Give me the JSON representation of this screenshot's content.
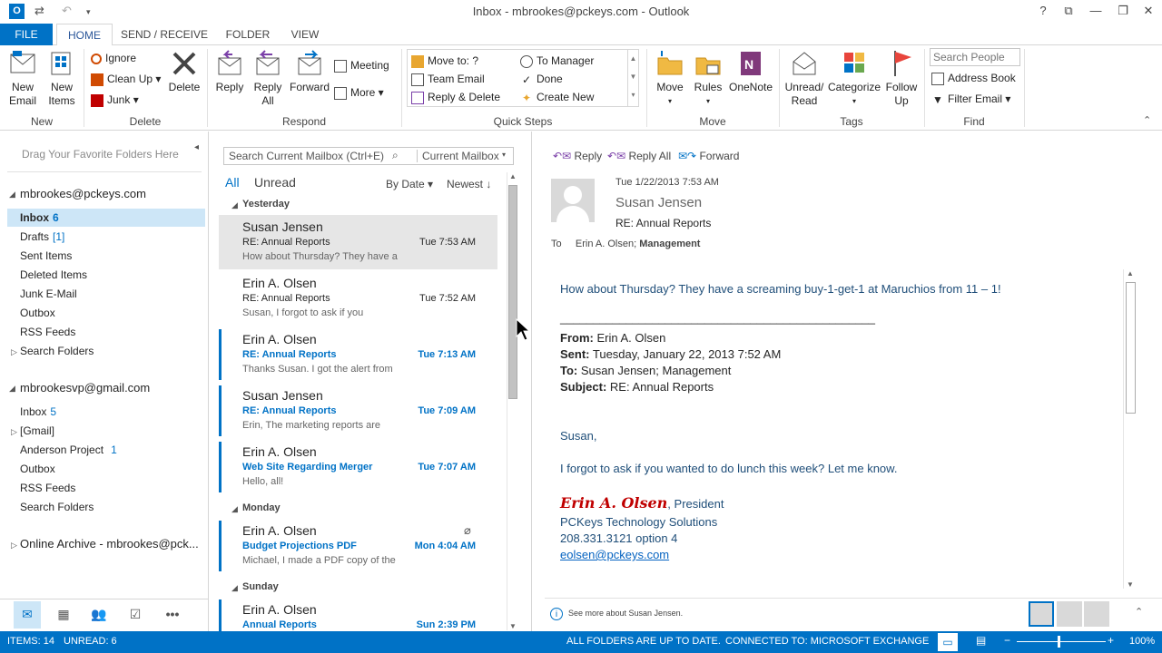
{
  "window": {
    "title": "Inbox - mbrookes@pckeys.com - Outlook"
  },
  "tabs": [
    "FILE",
    "HOME",
    "SEND / RECEIVE",
    "FOLDER",
    "VIEW"
  ],
  "ribbon": {
    "new_group": {
      "label": "New",
      "new_email": "New Email",
      "new_items": "New Items"
    },
    "delete_group": {
      "label": "Delete",
      "ignore": "Ignore",
      "clean_up": "Clean Up",
      "junk": "Junk",
      "delete": "Delete"
    },
    "respond_group": {
      "label": "Respond",
      "reply": "Reply",
      "reply_all": "Reply All",
      "forward": "Forward",
      "meeting": "Meeting",
      "more": "More"
    },
    "quick_steps": {
      "label": "Quick Steps",
      "items": [
        "Move to: ?",
        "Team Email",
        "Reply & Delete",
        "To Manager",
        "Done",
        "Create New"
      ]
    },
    "move_group": {
      "label": "Move",
      "move": "Move",
      "rules": "Rules",
      "onenote": "OneNote"
    },
    "tags_group": {
      "label": "Tags",
      "unread_read": "Unread/ Read",
      "categorize": "Categorize",
      "follow_up": "Follow Up"
    },
    "find_group": {
      "label": "Find",
      "search_people": "Search People",
      "address_book": "Address Book",
      "filter_email": "Filter Email"
    }
  },
  "nav": {
    "hint": "Drag Your Favorite Folders Here",
    "accounts": [
      {
        "name": "mbrookes@pckeys.com",
        "folders": [
          {
            "label": "Inbox",
            "count": "6"
          },
          {
            "label": "Drafts",
            "count": "[1]"
          },
          {
            "label": "Sent Items",
            "count": ""
          },
          {
            "label": "Deleted Items",
            "count": ""
          },
          {
            "label": "Junk E-Mail",
            "count": ""
          },
          {
            "label": "Outbox",
            "count": ""
          },
          {
            "label": "RSS Feeds",
            "count": ""
          },
          {
            "label": "Search Folders",
            "count": ""
          }
        ]
      },
      {
        "name": "mbrookesvp@gmail.com",
        "folders": [
          {
            "label": "Inbox",
            "count": "5"
          },
          {
            "label": "[Gmail]",
            "count": ""
          },
          {
            "label": "Anderson Project",
            "count": "1"
          },
          {
            "label": "Outbox",
            "count": ""
          },
          {
            "label": "RSS Feeds",
            "count": ""
          },
          {
            "label": "Search Folders",
            "count": ""
          }
        ]
      }
    ],
    "archive": "Online Archive - mbrookes@pck..."
  },
  "list": {
    "search_placeholder": "Search Current Mailbox (Ctrl+E)",
    "scope": "Current Mailbox",
    "filter_all": "All",
    "filter_unread": "Unread",
    "sort_by": "By Date",
    "sort_order": "Newest",
    "groups": [
      "Yesterday",
      "Monday",
      "Sunday"
    ],
    "messages": [
      {
        "from": "Susan Jensen",
        "subject": "RE: Annual Reports",
        "time": "Tue 7:53 AM",
        "preview": "How about Thursday? They have a",
        "unread": false
      },
      {
        "from": "Erin A. Olsen",
        "subject": "RE: Annual Reports",
        "time": "Tue 7:52 AM",
        "preview": "Susan,  I forgot to ask if you",
        "unread": false
      },
      {
        "from": "Erin A. Olsen",
        "subject": "RE: Annual Reports",
        "time": "Tue 7:13 AM",
        "preview": "Thanks Susan. I got the alert from",
        "unread": true
      },
      {
        "from": "Susan Jensen",
        "subject": "RE: Annual Reports",
        "time": "Tue 7:09 AM",
        "preview": "Erin,  The marketing reports are",
        "unread": true
      },
      {
        "from": "Erin A. Olsen",
        "subject": "Web Site Regarding Merger",
        "time": "Tue 7:07 AM",
        "preview": "Hello, all!",
        "unread": true
      },
      {
        "from": "Erin A. Olsen",
        "subject": "Budget Projections PDF",
        "time": "Mon 4:04 AM",
        "preview": "Michael,  I made a PDF copy of the",
        "unread": true
      },
      {
        "from": "Erin A. Olsen",
        "subject": "Annual Reports",
        "time": "Sun 2:39 PM",
        "preview": "",
        "unread": true
      }
    ]
  },
  "reading": {
    "actions": {
      "reply": "Reply",
      "reply_all": "Reply All",
      "forward": "Forward"
    },
    "date": "Tue 1/22/2013 7:53 AM",
    "sender": "Susan Jensen",
    "subject": "RE: Annual Reports",
    "to_label": "To",
    "to_value": "Erin A. Olsen;",
    "to_group": "Management",
    "body_line1": "How about Thursday? They have a screaming buy-1-get-1 at Maruchios from 11 – 1!",
    "divider": "________________________________________________",
    "from_label": "From:",
    "from_value": "Erin A. Olsen",
    "sent_label": "Sent:",
    "sent_value": "Tuesday, January 22, 2013 7:52 AM",
    "to2_label": "To:",
    "to2_value": "Susan Jensen; Management",
    "subject_label": "Subject:",
    "subject_value": "RE: Annual Reports",
    "greeting": "Susan,",
    "body_line2": "I forgot to ask if you wanted to do lunch this week? Let me know.",
    "sig_name": "Erin A. Olsen",
    "sig_title": ", President",
    "sig_company": "PCKeys Technology Solutions",
    "sig_phone": "208.331.3121 option 4",
    "sig_email": "eolsen@pckeys.com",
    "people_info": "See more about Susan Jensen."
  },
  "status": {
    "items": "ITEMS: 14",
    "unread": "UNREAD: 6",
    "sync": "ALL FOLDERS ARE UP TO DATE.",
    "connection": "CONNECTED TO: MICROSOFT EXCHANGE",
    "zoom": "100%"
  },
  "colors": {
    "accent": "#0072c6",
    "signature": "#c00000"
  }
}
